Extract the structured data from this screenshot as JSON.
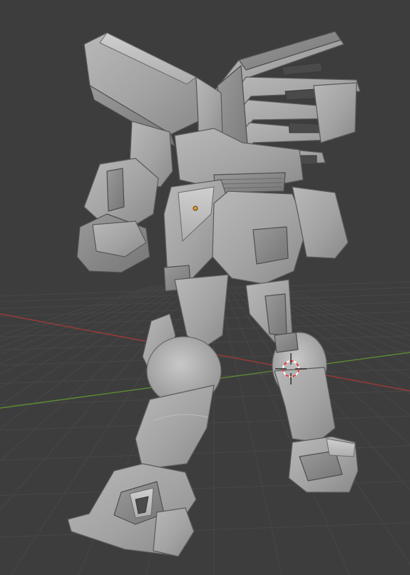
{
  "viewport": {
    "background": "#3d3d3d",
    "grid_color": "#474747",
    "axis_x_color": "#9c3a3a",
    "axis_y_color": "#5d8a32"
  },
  "scene": {
    "subject": "mech-model-back-view",
    "shading": "solid-gray",
    "origin_marker_color": "#e8962c",
    "cursor_color": "#e33a3a"
  },
  "icons": {
    "origin": "origin-dot-icon",
    "cursor": "3d-cursor-icon"
  }
}
